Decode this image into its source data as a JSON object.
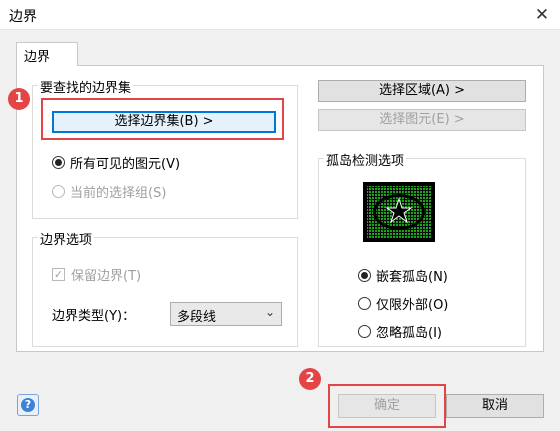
{
  "window": {
    "title": "边界",
    "close_glyph": "✕"
  },
  "tab": {
    "label": "边界"
  },
  "boundary_set": {
    "title": "要查找的边界集",
    "select_button": "选择边界集(B)  >",
    "radio_visible": "所有可见的图元(V)",
    "radio_current": "当前的选择组(S)"
  },
  "right_buttons": {
    "select_region": "选择区域(A)  >",
    "select_objects": "选择图元(E)  >"
  },
  "island": {
    "title": "孤岛检测选项",
    "options": [
      "嵌套孤岛(N)",
      "仅限外部(O)",
      "忽略孤岛(I)"
    ]
  },
  "boundary_options": {
    "title": "边界选项",
    "keep_boundary": "保留边界(T)",
    "type_label": "边界类型(Y)：",
    "type_value": "多段线",
    "checkmark": "✓"
  },
  "footer": {
    "ok": "确定",
    "cancel": "取消",
    "help": "?"
  },
  "badges": {
    "one": "1",
    "two": "2"
  },
  "colors": {
    "highlight": "#e34446",
    "focus": "#0078d7",
    "preview_green": "#1aa51a"
  }
}
